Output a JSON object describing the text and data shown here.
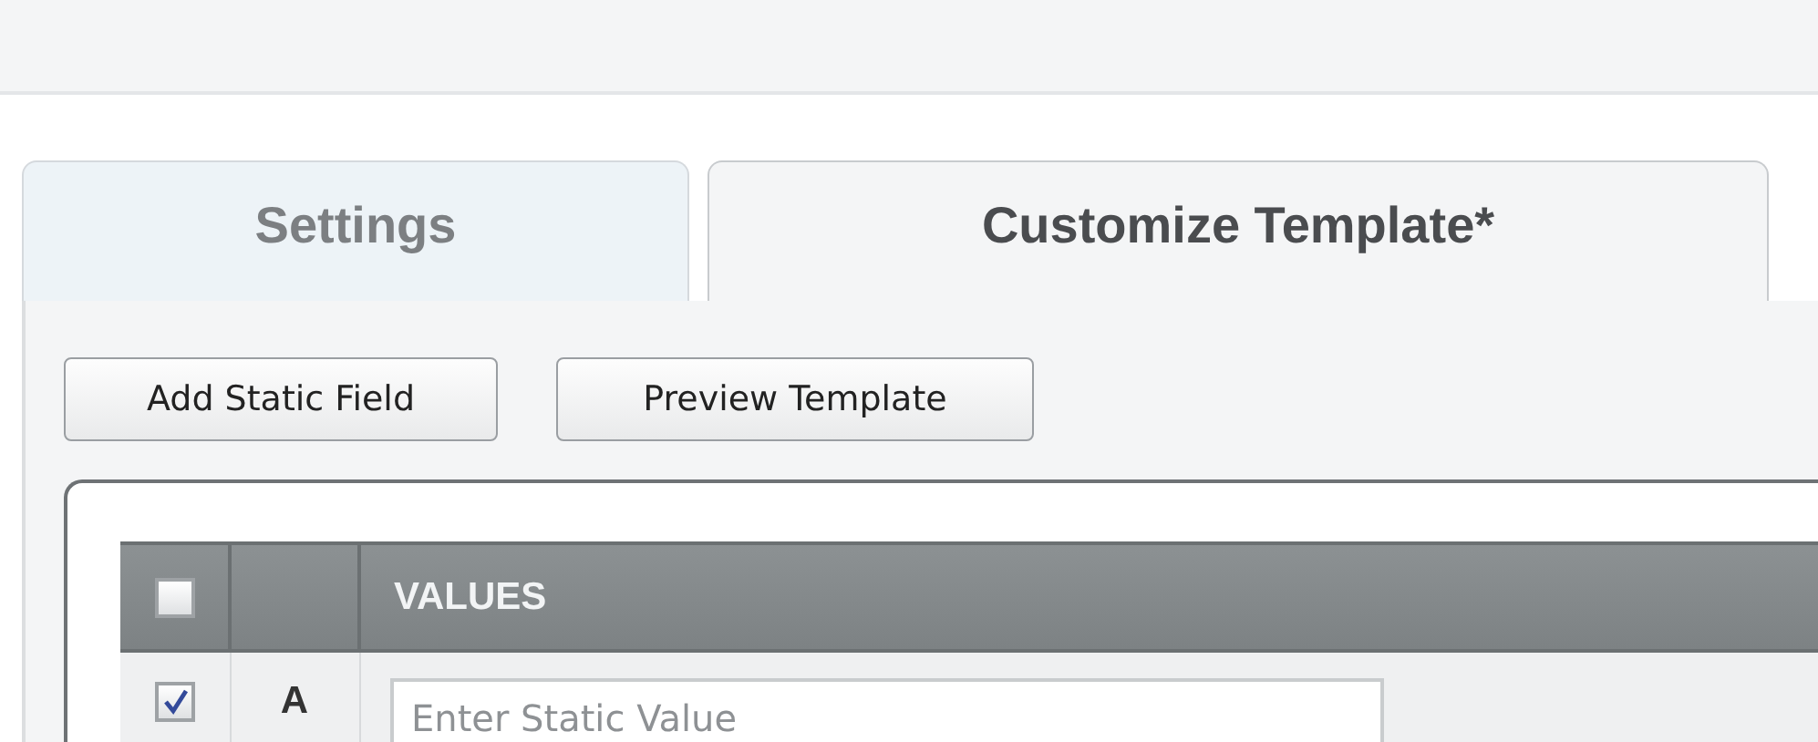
{
  "tabs": [
    {
      "label": "Settings",
      "selected": false
    },
    {
      "label": "Customize Template*",
      "selected": true
    }
  ],
  "buttons": [
    "Add Static Field",
    "Preview Template"
  ],
  "table": {
    "header_checked": false,
    "columns": [
      "VALUES"
    ],
    "rows": [
      {
        "checked": true,
        "letter": "A",
        "placeholder": "Enter Static Value"
      }
    ]
  }
}
